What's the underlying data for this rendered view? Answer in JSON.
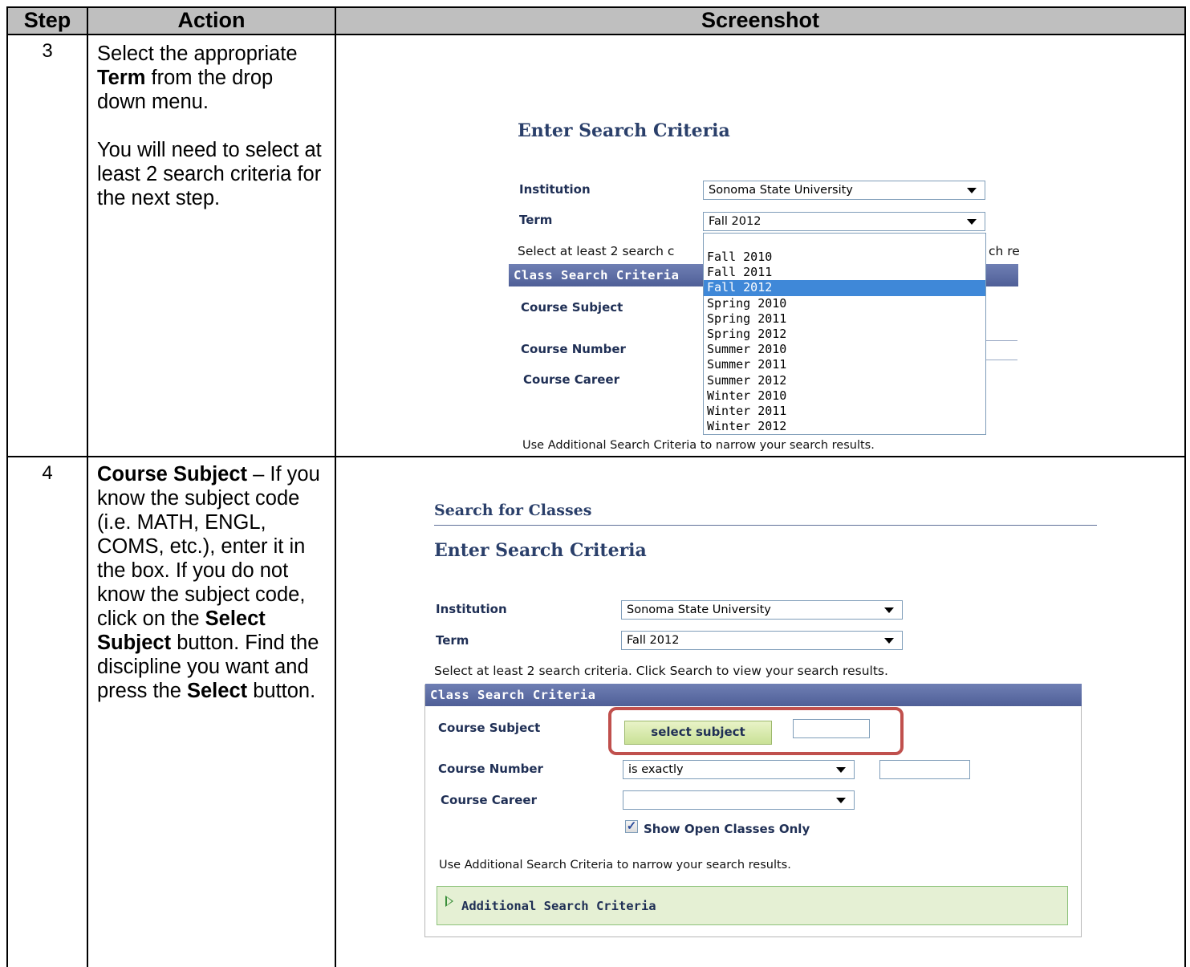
{
  "table": {
    "headers": {
      "step": "Step",
      "action": "Action",
      "screenshot": "Screenshot"
    }
  },
  "rows": [
    {
      "step": "3",
      "action": {
        "p1_a": "Select the appropriate ",
        "p1_bold": "Term",
        "p1_b": " from the drop down menu.",
        "p2": "You will need to select at least 2 search criteria for the next step."
      },
      "shot": {
        "heading": "Enter Search Criteria",
        "institution_label": "Institution",
        "institution_value": "Sonoma State University",
        "term_label": "Term",
        "term_value": "Fall 2012",
        "instruction_partial_left": "Select at least 2 search c",
        "instruction_partial_right": "ch re",
        "bar_title": "Class Search Criteria",
        "course_subject_label": "Course Subject",
        "course_number_label": "Course Number",
        "course_career_label": "Course Career",
        "term_options": [
          "Fall 2010",
          "Fall 2011",
          "Fall 2012",
          "Spring 2010",
          "Spring 2011",
          "Spring 2012",
          "Summer 2010",
          "Summer 2011",
          "Summer 2012",
          "Winter 2010",
          "Winter 2011",
          "Winter 2012"
        ],
        "term_selected": "Fall 2012",
        "bottom_note": "Use Additional Search Criteria to narrow your search results."
      }
    },
    {
      "step": "4",
      "action": {
        "bold1": "Course Subject",
        "t1": " – If you know the subject code (i.e. MATH, ENGL, COMS, etc.), enter it in the box.  If you do not know the subject code, click on the ",
        "bold2": "Select Subject",
        "t2": " button.  Find the discipline you want and press the ",
        "bold3": "Select",
        "t3": " button."
      },
      "shot": {
        "page_title": "Search for Classes",
        "heading": "Enter Search Criteria",
        "institution_label": "Institution",
        "institution_value": "Sonoma State University",
        "term_label": "Term",
        "term_value": "Fall 2012",
        "instruction": "Select at least 2 search criteria. Click Search to view your search results.",
        "bar_title": "Class Search Criteria",
        "course_subject_label": "Course Subject",
        "select_subject_button": "select subject",
        "course_number_label": "Course Number",
        "course_number_op": "is exactly",
        "course_career_label": "Course Career",
        "course_career_value": "",
        "show_open_label": "Show Open Classes Only",
        "show_open_checked": "✓",
        "bottom_note": "Use Additional Search Criteria to narrow your search results.",
        "additional_label": "Additional Search Criteria",
        "highlight_color": "#c0504d"
      }
    }
  ]
}
